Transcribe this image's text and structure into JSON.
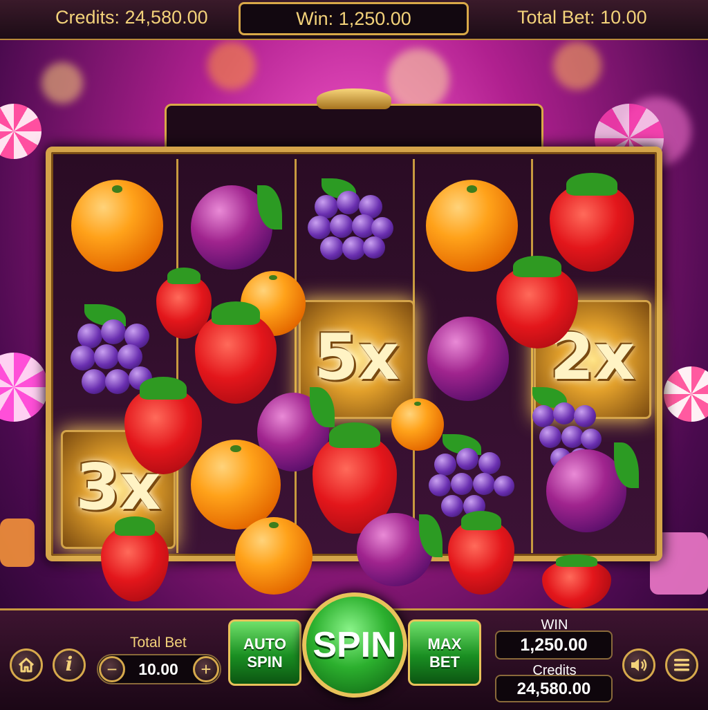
{
  "header": {
    "credits": "Credits: 24,580.00",
    "win": "Win: 1,250.00",
    "total_bet": "Total Bet: 10.00"
  },
  "reels": {
    "multipliers": [
      "3x",
      "5x",
      "2x"
    ],
    "symbols": [
      "orange",
      "plum",
      "grapes",
      "orange",
      "strawberry",
      "grapes",
      "strawberry",
      "orange",
      "plum",
      "strawberry",
      "grapes",
      "orange",
      "plum",
      "strawberry"
    ]
  },
  "controls": {
    "total_bet_label": "Total Bet",
    "total_bet_value": "10.00",
    "minus": "−",
    "plus": "+",
    "auto_spin": [
      "AUTO",
      "SPIN"
    ],
    "spin": "SPIN",
    "max_bet": [
      "MAX",
      "BET"
    ],
    "win_label": "WIN",
    "win_value": "1,250.00",
    "credits_label": "Credits",
    "credits_value": "24,580.00",
    "info": "i"
  },
  "icons": {
    "home": "home-icon",
    "info": "info-icon",
    "sound": "speaker-icon",
    "menu": "menu-icon"
  },
  "colors": {
    "gold": "#f3d27a",
    "spin_green": "#2cb02e",
    "frame_gold": "#d4a44a"
  }
}
